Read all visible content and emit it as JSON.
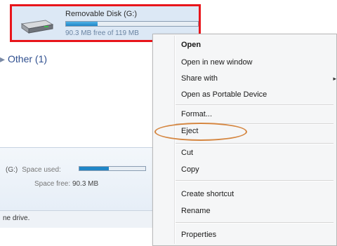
{
  "explorer": {
    "drive": {
      "name": "Removable Disk (G:)",
      "free_text": "90.3 MB free of 119 MB",
      "used_fraction": 0.24
    },
    "group_other": {
      "bullet": "▸",
      "label": "Other (1)"
    },
    "details": {
      "drive_suffix": "(G:)",
      "space_used_label": "Space used:",
      "space_used_fraction": 0.45,
      "space_free_label": "Space free:",
      "space_free_value": "90.3 MB"
    },
    "status": {
      "text": "ne drive."
    }
  },
  "context_menu": {
    "items": [
      {
        "label": "Open",
        "bold": true
      },
      {
        "label": "Open in new window"
      },
      {
        "label": "Share with",
        "has_submenu": true
      },
      {
        "label": "Open as Portable Device"
      },
      {
        "label": "Format..."
      },
      {
        "label": "Eject",
        "highlighted": true
      },
      {
        "label": "Cut"
      },
      {
        "label": "Copy"
      },
      {
        "label": "Create shortcut"
      },
      {
        "label": "Rename"
      },
      {
        "label": "Properties"
      }
    ],
    "submenu_arrow": "▸"
  },
  "colors": {
    "highlight_border": "#e8151b",
    "eject_oval": "#d58640",
    "selection_bg": "#dce8f5"
  }
}
